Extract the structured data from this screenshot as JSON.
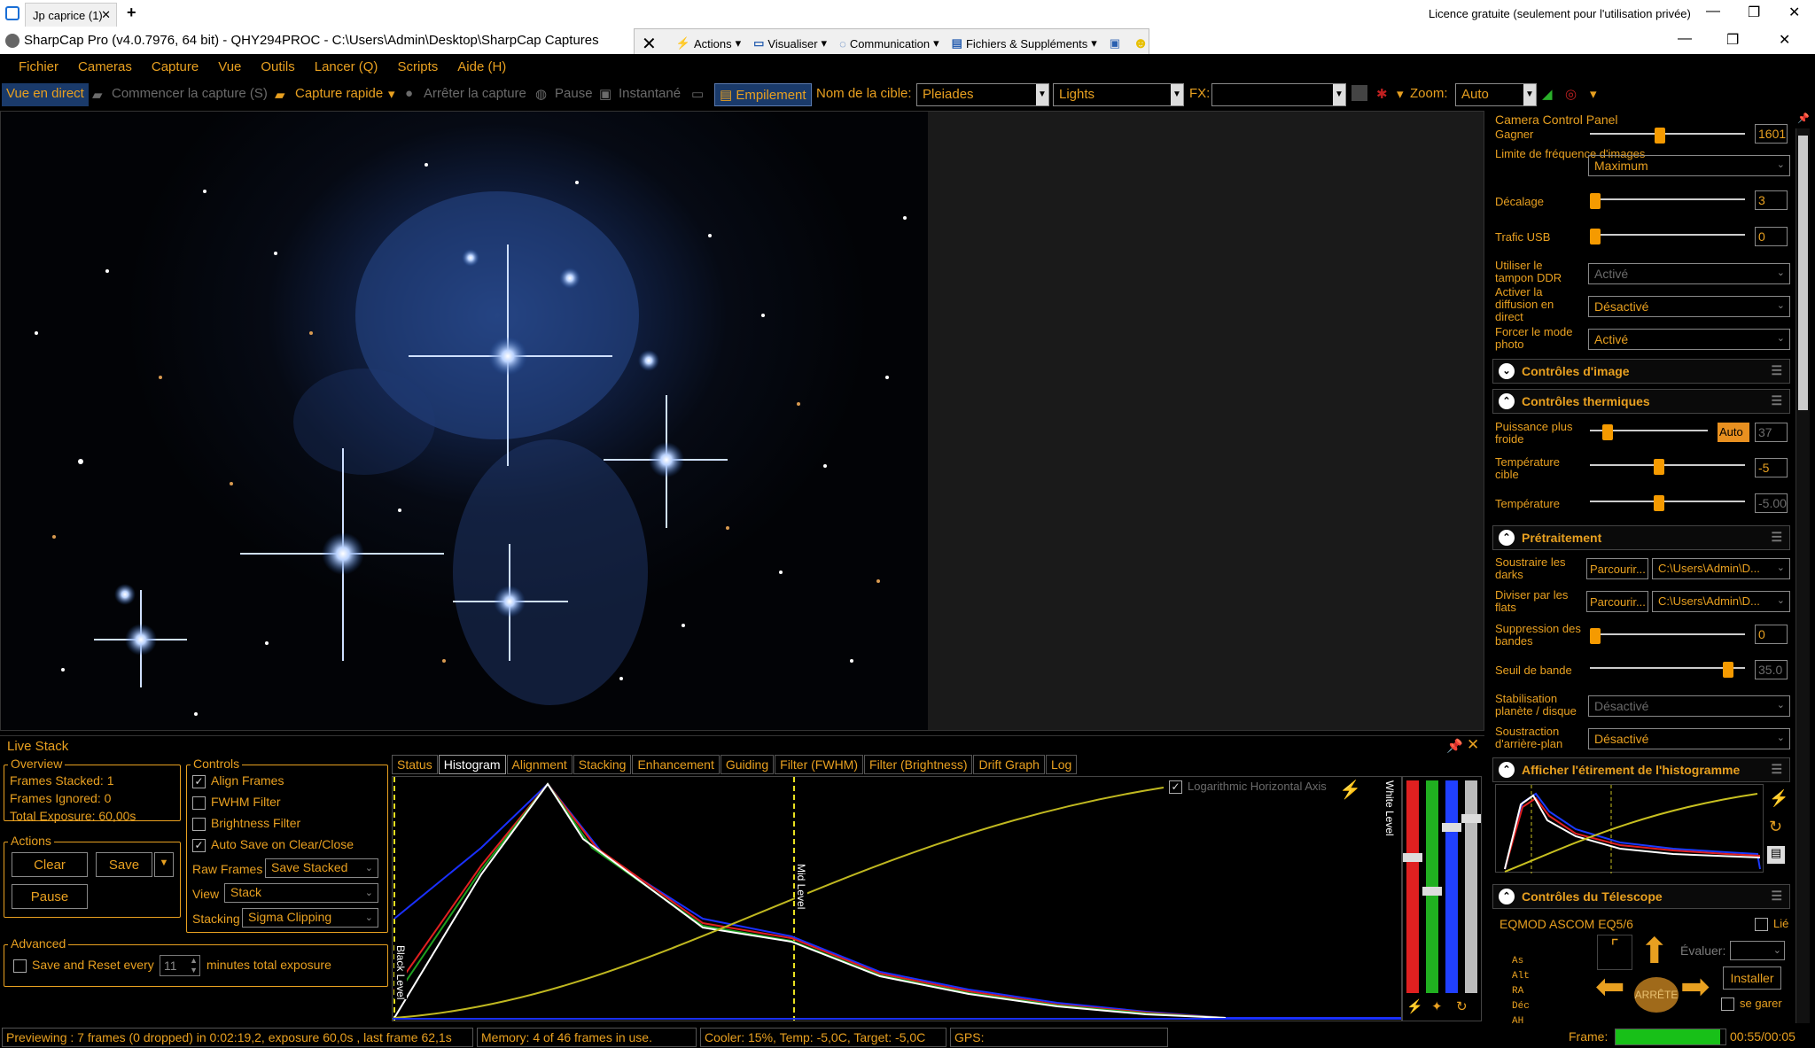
{
  "browser": {
    "tab_title": "Jp caprice (1)",
    "new_tab": "+",
    "license": "Licence gratuite (seulement pour l'utilisation privée)"
  },
  "window": {
    "title": "SharpCap Pro (v4.0.7976, 64 bit) - QHY294PROC - C:\\Users\\Admin\\Desktop\\SharpCap Captures"
  },
  "remote_toolbar": {
    "actions": "Actions",
    "visualiser": "Visualiser",
    "communication": "Communication",
    "fichiers": "Fichiers & Suppléments"
  },
  "menu": [
    "Fichier",
    "Cameras",
    "Capture",
    "Vue",
    "Outils",
    "Lancer (Q)",
    "Scripts",
    "Aide (H)"
  ],
  "toolbar": {
    "live": "Vue en direct",
    "start_capture": "Commencer la capture (S)",
    "quick_capture": "Capture rapide",
    "stop_capture": "Arrêter la capture",
    "pause": "Pause",
    "snapshot": "Instantané",
    "stacking": "Empilement",
    "target_label": "Nom de la cible:",
    "target_value": "Pleiades",
    "frame_type": "Lights",
    "fx_label": "FX:",
    "fx_value": "",
    "zoom_label": "Zoom:",
    "zoom_value": "Auto"
  },
  "camera_panel": {
    "title": "Camera Control Panel",
    "gain_label": "Gagner",
    "gain_value": "1601",
    "gain_level": 0.45,
    "framerate_label": "Limite de fréquence d'images",
    "framerate_value": "Maximum",
    "offset_label": "Décalage",
    "offset_value": "3",
    "usb_label": "Trafic USB",
    "usb_value": "0",
    "ddr_label": "Utiliser le tampon DDR",
    "ddr_value": "Activé",
    "broadcast_label": "Activer la diffusion en direct",
    "broadcast_value": "Désactivé",
    "photo_label": "Forcer le mode photo",
    "photo_value": "Activé",
    "image_controls": "Contrôles d'image",
    "thermal": "Contrôles thermiques",
    "cooler_label": "Puissance plus froide",
    "cooler_auto": "Auto",
    "cooler_value": "37",
    "target_temp_label": "Température cible",
    "target_temp_value": "-5",
    "temp_label": "Température",
    "temp_value": "-5.00",
    "preprocessing": "Prétraitement",
    "darks_label": "Soustraire les darks",
    "darks_button": "Parcourir...",
    "darks_path": "C:\\Users\\Admin\\D...",
    "flats_label": "Diviser par les flats",
    "flats_button": "Parcourir...",
    "flats_path": "C:\\Users\\Admin\\D...",
    "banding_label": "Suppression des bandes",
    "banding_value": "0",
    "band_threshold_label": "Seuil de bande",
    "band_threshold_value": "35.0",
    "stabilization_label": "Stabilisation planète / disque",
    "stabilization_value": "Désactivé",
    "background_label": "Soustraction d'arrière-plan",
    "background_value": "Désactivé",
    "stretch_title": "Afficher l'étirement de l'histogramme",
    "telescope": "Contrôles du Télescope",
    "mount_name": "EQMOD ASCOM EQ5/6",
    "linked": "Lié",
    "evaluate": "Évaluer:",
    "install": "Installer",
    "park": "se garer",
    "stop": "ARRÊTE",
    "coords": [
      "As",
      "Alt",
      "RA",
      "Déc",
      "AH"
    ]
  },
  "live_stack": {
    "title": "Live Stack",
    "overview_title": "Overview",
    "frames_stacked": "Frames Stacked:  1",
    "frames_ignored": "Frames Ignored:  0",
    "total_exposure": "Total Exposure:   60,00s",
    "actions_title": "Actions",
    "clear": "Clear",
    "save": "Save",
    "pause": "Pause",
    "advanced_title": "Advanced",
    "save_reset": "Save and Reset every",
    "save_reset_value": "11",
    "save_reset_suffix": "minutes total exposure",
    "controls_title": "Controls",
    "align": "Align Frames",
    "fwhm": "FWHM Filter",
    "brightness": "Brightness Filter",
    "autosave": "Auto Save on Clear/Close",
    "raw_label": "Raw Frames",
    "raw_value": "Save Stacked",
    "view_label": "View",
    "view_value": "Stack",
    "stacking_label": "Stacking",
    "stacking_value": "Sigma Clipping",
    "tabs": [
      "Status",
      "Histogram",
      "Alignment",
      "Stacking",
      "Enhancement",
      "Guiding",
      "Filter (FWHM)",
      "Filter (Brightness)",
      "Drift Graph",
      "Log"
    ],
    "log_axis": "Logarithmic Horizontal Axis",
    "black_level": "Black Level",
    "mid_level": "Mid Level",
    "white_level": "White Level"
  },
  "status": {
    "preview": "Previewing : 7 frames (0 dropped) in 0:02:19,2, exposure 60,0s , last frame 62,1s",
    "memory": "Memory: 4 of 46 frames in use.",
    "cooler": "Cooler: 15%, Temp: -5,0C, Target: -5,0C",
    "gps": "GPS:",
    "frame_label": "Frame:",
    "frame_time": "00:55/00:05",
    "frame_progress": 0.95
  },
  "colors": {
    "accent": "#e8a020",
    "background": "#000000",
    "slider": "#f59a00"
  }
}
